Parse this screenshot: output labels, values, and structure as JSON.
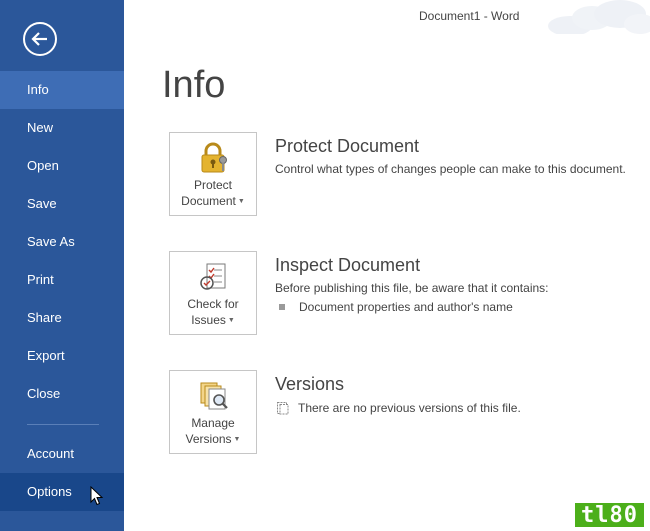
{
  "window": {
    "title": "Document1 - Word"
  },
  "sidebar": {
    "back_icon": "back-arrow-icon",
    "items": [
      {
        "label": "Info",
        "state": "active"
      },
      {
        "label": "New"
      },
      {
        "label": "Open"
      },
      {
        "label": "Save"
      },
      {
        "label": "Save As"
      },
      {
        "label": "Print"
      },
      {
        "label": "Share"
      },
      {
        "label": "Export"
      },
      {
        "label": "Close"
      },
      {
        "label": "Account"
      },
      {
        "label": "Options",
        "state": "hover"
      }
    ]
  },
  "main": {
    "title": "Info",
    "sections": [
      {
        "button": {
          "line1": "Protect",
          "line2": "Document"
        },
        "heading": "Protect Document",
        "description": "Control what types of changes people can make to this document.",
        "icon": "lock-key-icon"
      },
      {
        "button": {
          "line1": "Check for",
          "line2": "Issues"
        },
        "heading": "Inspect Document",
        "description": "Before publishing this file, be aware that it contains:",
        "bullet": "Document properties and author's name",
        "icon": "inspect-checklist-icon"
      },
      {
        "button": {
          "line1": "Manage",
          "line2": "Versions"
        },
        "heading": "Versions",
        "note": "There are no previous versions of this file.",
        "icon": "manage-versions-icon"
      }
    ]
  },
  "colors": {
    "sidebar_bg": "#2b579a",
    "sidebar_active": "#3e6db5",
    "sidebar_hover": "#19478a",
    "text": "#444444"
  },
  "watermark": "tl80"
}
